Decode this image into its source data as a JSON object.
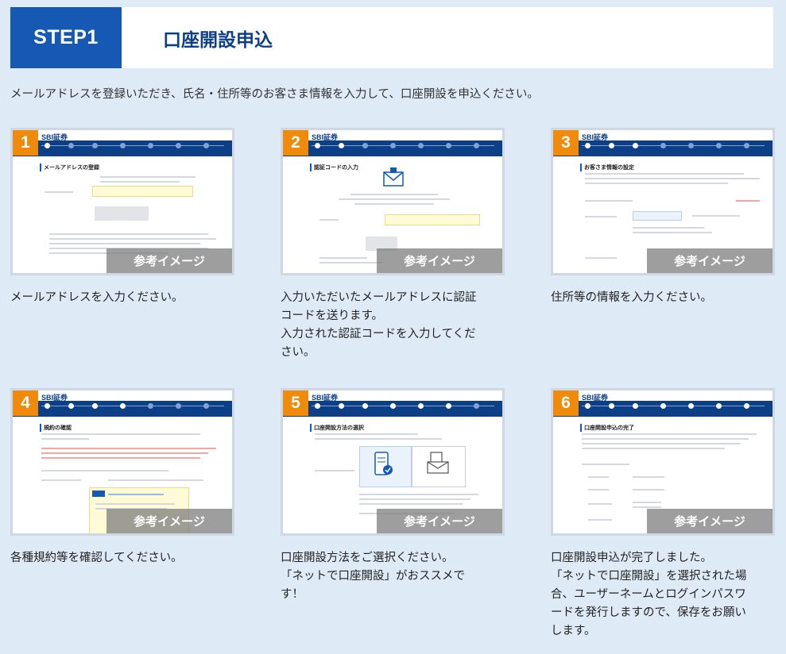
{
  "header": {
    "step": "STEP1",
    "title": "口座開設申込"
  },
  "intro": "メールアドレスを登録いただき、氏名・住所等のお客さま情報を入力して、口座開設を申込ください。",
  "ref_label": "参考イメージ",
  "logo": "SBI証券",
  "steps": [
    {
      "num": "1",
      "mini_title": "メールアドレスの登録",
      "desc": "メールアドレスを入力ください。"
    },
    {
      "num": "2",
      "mini_title": "認証コードの入力",
      "desc": "入力いただいたメールアドレスに認証\nコードを送ります。\n入力された認証コードを入力してくだ\nさい。"
    },
    {
      "num": "3",
      "mini_title": "お客さま情報の設定",
      "desc": "住所等の情報を入力ください。"
    },
    {
      "num": "4",
      "mini_title": "規約の確認",
      "desc": "各種規約等を確認してください。"
    },
    {
      "num": "5",
      "mini_title": "口座開設方法の選択",
      "desc": "口座開設方法をご選択ください。\n「ネットで口座開設」がおススメで\nす！"
    },
    {
      "num": "6",
      "mini_title": "口座開設申込の完了",
      "desc": "口座開設申込が完了しました。\n「ネットで口座開設」を選択された場\n合、ユーザーネームとログインパスワ\nードを発行しますので、保存をお願い\nします。"
    }
  ],
  "colors": {
    "brand_blue": "#1559b5",
    "accent_orange": "#f08a0a",
    "background": "#dfeaf7"
  }
}
